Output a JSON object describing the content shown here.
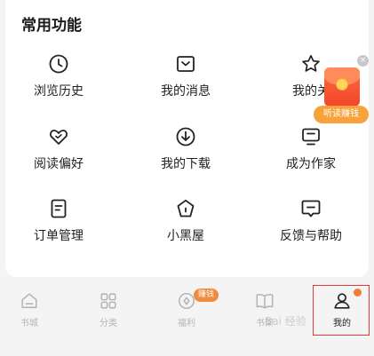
{
  "section": {
    "title": "常用功能"
  },
  "features": [
    {
      "label": "浏览历史",
      "icon": "clock-icon"
    },
    {
      "label": "我的消息",
      "icon": "inbox-icon"
    },
    {
      "label": "我的关",
      "icon": "star-icon"
    },
    {
      "label": "阅读偏好",
      "icon": "heart-icon"
    },
    {
      "label": "我的下载",
      "icon": "download-icon"
    },
    {
      "label": "成为作家",
      "icon": "monitor-icon"
    },
    {
      "label": "订单管理",
      "icon": "document-icon"
    },
    {
      "label": "小黑屋",
      "icon": "pentagon-house-icon"
    },
    {
      "label": "反馈与帮助",
      "icon": "feedback-icon"
    }
  ],
  "promo": {
    "label": "听读赚钱",
    "close": "×",
    "icon": "red-envelope-icon"
  },
  "tabs": [
    {
      "label": "书城",
      "icon": "bookstore-icon"
    },
    {
      "label": "分类",
      "icon": "grid-icon"
    },
    {
      "label": "福利",
      "icon": "coin-icon",
      "badge": "赚钱"
    },
    {
      "label": "书架",
      "icon": "book-icon"
    },
    {
      "label": "我的",
      "icon": "user-icon",
      "active": true
    }
  ],
  "watermark": "Bai 经验",
  "colors": {
    "accent": "#f08a3c",
    "highlight": "#e23a3a",
    "promo_red": "#f2462b"
  }
}
